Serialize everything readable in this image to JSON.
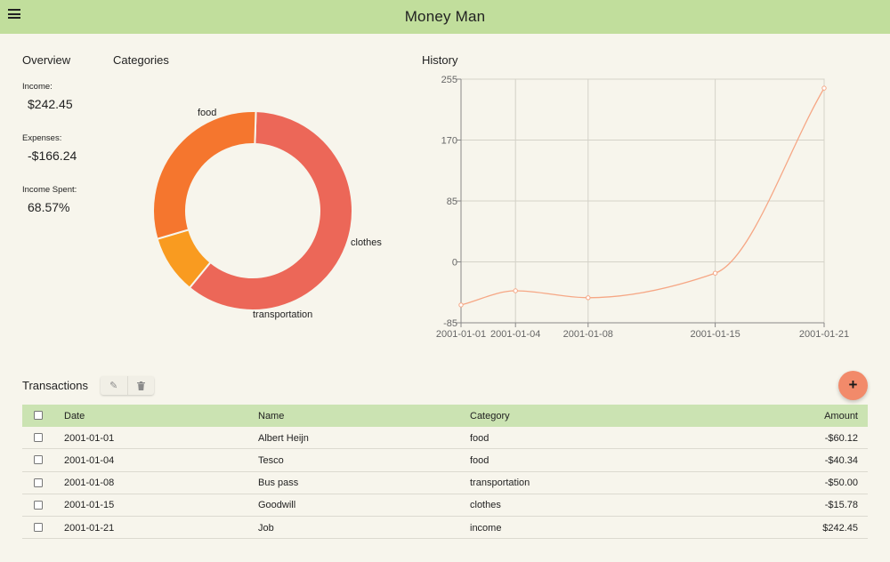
{
  "header": {
    "title": "Money Man",
    "menu_icon": "hamburger-icon"
  },
  "overview": {
    "title": "Overview",
    "income_label": "Income:",
    "income_value": "$242.45",
    "expenses_label": "Expenses:",
    "expenses_value": "-$166.24",
    "spent_label": "Income Spent:",
    "spent_value": "68.57%"
  },
  "categories": {
    "title": "Categories"
  },
  "history": {
    "title": "History"
  },
  "chart_data": [
    {
      "type": "pie",
      "title": "Categories",
      "labels": [
        "food",
        "clothes",
        "transportation"
      ],
      "values": [
        100.46,
        15.78,
        50.0
      ],
      "colors": [
        "#ec6758",
        "#f99b20",
        "#f5762e"
      ],
      "donut": true
    },
    {
      "type": "line",
      "title": "History",
      "x": [
        "2001-01-01",
        "2001-01-04",
        "2001-01-08",
        "2001-01-15",
        "2001-01-21"
      ],
      "y": [
        -60.12,
        -40.34,
        -50.0,
        -15.78,
        242.45
      ],
      "ylim": [
        -85,
        255
      ],
      "yticks": [
        -85,
        0,
        85,
        170,
        255
      ],
      "grid": true,
      "color": "#f6a785"
    }
  ],
  "transactions": {
    "title": "Transactions",
    "edit_icon": "pencil-icon",
    "delete_icon": "trash-icon",
    "add_label": "+",
    "columns": {
      "date": "Date",
      "name": "Name",
      "category": "Category",
      "amount": "Amount"
    },
    "rows": [
      {
        "date": "2001-01-01",
        "name": "Albert Heijn",
        "category": "food",
        "amount": "-$60.12"
      },
      {
        "date": "2001-01-04",
        "name": "Tesco",
        "category": "food",
        "amount": "-$40.34"
      },
      {
        "date": "2001-01-08",
        "name": "Bus pass",
        "category": "transportation",
        "amount": "-$50.00"
      },
      {
        "date": "2001-01-15",
        "name": "Goodwill",
        "category": "clothes",
        "amount": "-$15.78"
      },
      {
        "date": "2001-01-21",
        "name": "Job",
        "category": "income",
        "amount": "$242.45"
      }
    ]
  }
}
